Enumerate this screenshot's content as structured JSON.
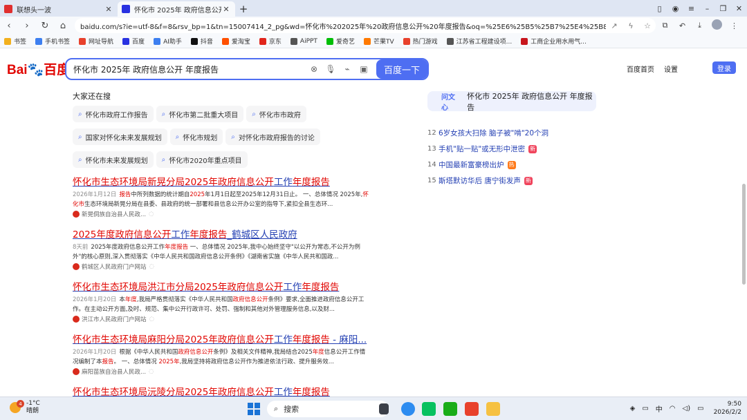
{
  "browser": {
    "tabs": [
      {
        "title": "联想头一波",
        "favicon_color": "#e02f2f",
        "active": false
      },
      {
        "title": "怀化市 2025年 政府信息公开 年度",
        "favicon_color": "#2932e1",
        "active": true
      }
    ],
    "new_tab": "+",
    "url": "baidu.com/s?ie=utf-8&f=8&rsv_bp=1&tn=15007414_2_pg&wd=怀化市%202025年%20政府信息公开%20年度报告&oq=%25E6%25B5%25B7%25E4%25B8%259C%25E5%25B8%2582%..."
  },
  "bookmarks": [
    {
      "label": "书签",
      "color": "#f2b01e"
    },
    {
      "label": "手机书签",
      "color": "#3d7ff0"
    },
    {
      "label": "网址导航",
      "color": "#e8412c"
    },
    {
      "label": "百度",
      "color": "#2932e1"
    },
    {
      "label": "AI助手",
      "color": "#3d7ff0"
    },
    {
      "label": "抖音",
      "color": "#111111"
    },
    {
      "label": "爱淘宝",
      "color": "#ff5000"
    },
    {
      "label": "京东",
      "color": "#e1251b"
    },
    {
      "label": "AiPPT",
      "color": "#555555"
    },
    {
      "label": "爱奇艺",
      "color": "#00be06"
    },
    {
      "label": "芒果TV",
      "color": "#ff7a00"
    },
    {
      "label": "热门游戏",
      "color": "#e8412c"
    },
    {
      "label": "江苏省工程建设项...",
      "color": "#555555"
    },
    {
      "label": "工商企业用水用气...",
      "color": "#c8161d"
    }
  ],
  "baidu": {
    "logo": {
      "bai": "Bai",
      "paw": "🐾",
      "du": "百度"
    },
    "query": "怀化市 2025年 政府信息公开 年度报告",
    "search_button": "百度一下",
    "header_links": [
      "百度首页",
      "设置"
    ],
    "login": "登录"
  },
  "related": {
    "title": "大家还在搜",
    "items": [
      "怀化市政府工作报告",
      "怀化市第二批重大项目",
      "怀化市市政府",
      "国家对怀化未来发展规划",
      "怀化市规划",
      "对怀化市政府报告的讨论",
      "怀化市未来发展规划",
      "怀化市2020年重点项目"
    ]
  },
  "results": [
    {
      "title": [
        {
          "t": "怀化市生态环境局新晃分局",
          "hl": true
        },
        {
          "t": "2025年政府信息公开",
          "hl": true
        },
        {
          "t": "工作",
          "hl": false
        },
        {
          "t": "年度报告",
          "hl": true
        }
      ],
      "date": "2026年1月12日",
      "abstract": [
        {
          "t": "报告",
          "hl": true
        },
        {
          "t": "中所列数据的统计期自",
          "hl": false
        },
        {
          "t": "2025",
          "hl": true
        },
        {
          "t": "年1月1日起至2025年12月31日止。   一、总体情况   2025年,",
          "hl": false
        },
        {
          "t": "怀化市",
          "hl": true
        },
        {
          "t": "生态环境局新晃分局在县委、县政府的统一部署和县信息公开办公室的指导下,紧扣全县生态环...",
          "hl": false
        }
      ],
      "source": "新晃侗族自治县人民政..."
    },
    {
      "title": [
        {
          "t": "2025年度政府信息公开",
          "hl": true
        },
        {
          "t": "工作",
          "hl": false
        },
        {
          "t": "年度报告",
          "hl": true
        },
        {
          "t": "_鹤城区人民政府",
          "hl": false
        }
      ],
      "date": "8天前",
      "abstract": [
        {
          "t": "2025年度政府信息公开工作",
          "hl": false
        },
        {
          "t": "年度报告",
          "hl": true
        },
        {
          "t": " 一、总体情况 2025年,我中心始终坚守\"以公开为常态,不公开为例外\"的核心原则,深入贯彻落实《中华人民共和国政府信息公开条例》《湖南省实施《中华人民共和国政...",
          "hl": false
        }
      ],
      "source": "鹤城区人民政府门户网站"
    },
    {
      "title": [
        {
          "t": "怀化市生态环境局洪江市分局",
          "hl": true
        },
        {
          "t": "2025年政府信息公开",
          "hl": true
        },
        {
          "t": "工作",
          "hl": false
        },
        {
          "t": "年度报告",
          "hl": true
        }
      ],
      "date": "2026年1月20日",
      "abstract": [
        {
          "t": "本",
          "hl": false
        },
        {
          "t": "年度",
          "hl": true
        },
        {
          "t": ",我局严格贯彻落实《中华人民共和国",
          "hl": false
        },
        {
          "t": "政府信息公开",
          "hl": true
        },
        {
          "t": "条例》要求,全面推进政府信息公开工作。在主动公开方面,及时、规范、集中公开行政许可、处罚、强制和其他对外管理服务信息,以及财...",
          "hl": false
        }
      ],
      "source": "洪江市人民政府门户网站"
    },
    {
      "title": [
        {
          "t": "怀化市生态环境局麻阳分局",
          "hl": true
        },
        {
          "t": "2025年政府信息公开",
          "hl": true
        },
        {
          "t": "工作",
          "hl": false
        },
        {
          "t": "年度报告",
          "hl": true
        },
        {
          "t": " - 麻阳...",
          "hl": false
        }
      ],
      "date": "2026年1月20日",
      "abstract": [
        {
          "t": "根据《中华人民共和国",
          "hl": false
        },
        {
          "t": "政府信息公开",
          "hl": true
        },
        {
          "t": "条例》及相关文件精神,我局结合2025",
          "hl": false
        },
        {
          "t": "年度",
          "hl": true
        },
        {
          "t": "信息公开工作情况编制了本",
          "hl": false
        },
        {
          "t": "报告",
          "hl": true
        },
        {
          "t": "。 一、总体情况 ",
          "hl": false
        },
        {
          "t": "2025年",
          "hl": true
        },
        {
          "t": ",我局坚持将政府信息公开作为推进依法行政、提升服务效...",
          "hl": false
        }
      ],
      "source": "麻阳苗族自治县人民政..."
    },
    {
      "title": [
        {
          "t": "怀化市生态环境局沅陵分局",
          "hl": true
        },
        {
          "t": "2025年政府信息公开",
          "hl": true
        },
        {
          "t": "工作",
          "hl": false
        },
        {
          "t": "年度报告",
          "hl": true
        }
      ],
      "date": "",
      "abstract": [],
      "source": ""
    }
  ],
  "sidebar": {
    "wenxin_label": "问文心",
    "wenxin_query": "怀化市 2025年 政府信息公开 年度报告",
    "hot": [
      {
        "num": "12",
        "text": "6岁女孩大扫除 脑子被\"啃\"20个洞",
        "tag": "",
        "tag_color": ""
      },
      {
        "num": "13",
        "text": "手机\"贴一贴\"或无形中泄密",
        "tag": "新",
        "tag_color": "#f0445c"
      },
      {
        "num": "14",
        "text": "中国最新富豪榜出炉",
        "tag": "热",
        "tag_color": "#ff7a1a"
      },
      {
        "num": "15",
        "text": "斯塔默访华后 唐宁街发声",
        "tag": "新",
        "tag_color": "#f0445c"
      }
    ]
  },
  "taskbar": {
    "weather_badge": "4",
    "temperature": "-1°C",
    "condition": "晴朗",
    "search_placeholder": "搜索",
    "ime": "中",
    "time": "9:50",
    "date": "2026/2/2"
  }
}
